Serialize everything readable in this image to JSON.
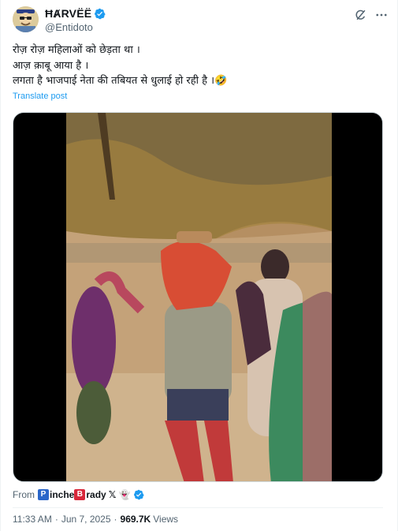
{
  "author": {
    "display_name": "ĦȺRVËË",
    "handle": "@Entidoto",
    "verified_icon": "verified-badge-icon",
    "avatar_icon": "cartoon-avatar"
  },
  "actions": {
    "grok_icon": "grok-icon",
    "more_icon": "more-options-icon"
  },
  "tweet": {
    "text": "रोज़ रोज़ महिलाओं को छेड़ता था ।\nआज़ क़ाबू आया है ।\nलगता है भाजपाई नेता की तबियत से धुलाई हो रही है ।🤣",
    "translate_label": "Translate post"
  },
  "media": {
    "kind": "video"
  },
  "source": {
    "from_label": "From",
    "name_boxes": [
      "P",
      "B"
    ],
    "name_part1": "inche",
    "name_part2": "rady",
    "name_suffix": "𝕏 👻"
  },
  "meta": {
    "time": "11:33 AM",
    "separator": "·",
    "date": "Jun 7, 2025",
    "views_count": "969.7K",
    "views_label": "Views"
  },
  "colors": {
    "accent": "#1d9bf0",
    "secondary_text": "#536471",
    "primary_text": "#0f1419"
  }
}
